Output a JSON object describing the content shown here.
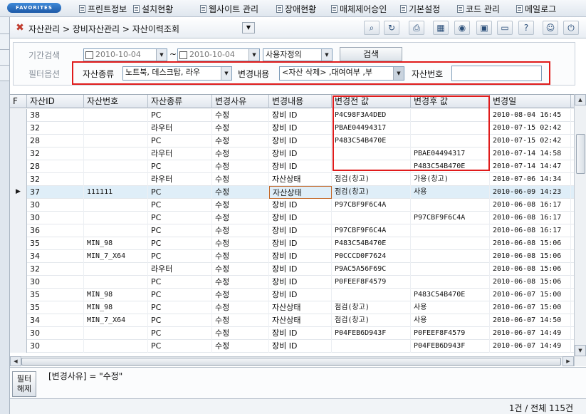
{
  "favorites": {
    "badge": "FAVORITES",
    "items": [
      "프린트정보",
      "설치현황",
      "웹사이트 관리",
      "장애현황",
      "매체제어승인",
      "기본설정",
      "코드 관리",
      "메일로그"
    ]
  },
  "breadcrumb": {
    "text": "자산관리 > 장비자산관리 > 자산이력조회"
  },
  "toolbar": {
    "icons": [
      "search-icon",
      "refresh-icon",
      "print-icon",
      "excel-icon",
      "disk-icon",
      "save-icon",
      "card-icon",
      "help-icon",
      "user-icon",
      "exit-icon"
    ]
  },
  "search": {
    "period_label": "기간검색",
    "date_from": "2010-10-04",
    "tilde": "~",
    "date_to": "2010-10-04",
    "period_type": "사용자정의",
    "search_button": "검색",
    "filter_label": "필터옵션",
    "asset_type_label": "자산종류",
    "asset_type_value": "노트북, 데스크탑, 라우",
    "change_label": "변경내용",
    "change_value": "<자산 삭제> ,대여여부 ,부",
    "asset_no_label": "자산번호",
    "asset_no_value": ""
  },
  "grid": {
    "columns": [
      "F",
      "자산ID",
      "자산번호",
      "자산종류",
      "변경사유",
      "변경내용",
      "변경전 값",
      "변경후 값",
      "변경일"
    ],
    "rows": [
      {
        "id": "38",
        "no": "",
        "type": "PC",
        "reason": "수정",
        "content": "장비 ID",
        "before": "P4C98F3A4DED",
        "after": "",
        "date": "2010-08-04 16:45",
        "extra": "2"
      },
      {
        "id": "32",
        "no": "",
        "type": "라우터",
        "reason": "수정",
        "content": "장비 ID",
        "before": "PBAE04494317",
        "after": "",
        "date": "2010-07-15 02:42",
        "extra": "2"
      },
      {
        "id": "28",
        "no": "",
        "type": "PC",
        "reason": "수정",
        "content": "장비 ID",
        "before": "P483C54B470E",
        "after": "",
        "date": "2010-07-15 02:42",
        "extra": "2"
      },
      {
        "id": "32",
        "no": "",
        "type": "라우터",
        "reason": "수정",
        "content": "장비 ID",
        "before": "",
        "after": "PBAE04494317",
        "date": "2010-07-14 14:58",
        "extra": "2"
      },
      {
        "id": "28",
        "no": "",
        "type": "PC",
        "reason": "수정",
        "content": "장비 ID",
        "before": "",
        "after": "P483C54B470E",
        "date": "2010-07-14 14:47",
        "extra": "2"
      },
      {
        "id": "32",
        "no": "",
        "type": "라우터",
        "reason": "수정",
        "content": "자산상태",
        "before": "점검(창고)",
        "after": "가용(창고)",
        "date": "2010-07-06 14:34",
        "extra": ""
      },
      {
        "id": "37",
        "no": "111111",
        "type": "PC",
        "reason": "수정",
        "content": "자산상태",
        "before": "점검(창고)",
        "after": "사용",
        "date": "2010-06-09 14:23",
        "extra": "",
        "selected": true
      },
      {
        "id": "30",
        "no": "",
        "type": "PC",
        "reason": "수정",
        "content": "장비 ID",
        "before": "P97CBF9F6C4A",
        "after": "",
        "date": "2010-06-08 16:17",
        "extra": "2"
      },
      {
        "id": "30",
        "no": "",
        "type": "PC",
        "reason": "수정",
        "content": "장비 ID",
        "before": "",
        "after": "P97CBF9F6C4A",
        "date": "2010-06-08 16:17",
        "extra": "2"
      },
      {
        "id": "36",
        "no": "",
        "type": "PC",
        "reason": "수정",
        "content": "장비 ID",
        "before": "P97CBF9F6C4A",
        "after": "",
        "date": "2010-06-08 16:17",
        "extra": "2"
      },
      {
        "id": "35",
        "no": "MIN_98",
        "type": "PC",
        "reason": "수정",
        "content": "장비 ID",
        "before": "P483C54B470E",
        "after": "",
        "date": "2010-06-08 15:06",
        "extra": "2"
      },
      {
        "id": "34",
        "no": "MIN_7_X64",
        "type": "PC",
        "reason": "수정",
        "content": "장비 ID",
        "before": "P0CCCD0F7624",
        "after": "",
        "date": "2010-06-08 15:06",
        "extra": "2"
      },
      {
        "id": "32",
        "no": "",
        "type": "라우터",
        "reason": "수정",
        "content": "장비 ID",
        "before": "P9AC5A56F69C",
        "after": "",
        "date": "2010-06-08 15:06",
        "extra": "2"
      },
      {
        "id": "30",
        "no": "",
        "type": "PC",
        "reason": "수정",
        "content": "장비 ID",
        "before": "P0FEEF8F4579",
        "after": "",
        "date": "2010-06-08 15:06",
        "extra": "2"
      },
      {
        "id": "35",
        "no": "MIN_98",
        "type": "PC",
        "reason": "수정",
        "content": "장비 ID",
        "before": "",
        "after": "P483C54B470E",
        "date": "2010-06-07 15:00",
        "extra": "2"
      },
      {
        "id": "35",
        "no": "MIN_98",
        "type": "PC",
        "reason": "수정",
        "content": "자산상태",
        "before": "점검(창고)",
        "after": "사용",
        "date": "2010-06-07 15:00",
        "extra": ""
      },
      {
        "id": "34",
        "no": "MIN_7_X64",
        "type": "PC",
        "reason": "수정",
        "content": "자산상태",
        "before": "점검(창고)",
        "after": "사용",
        "date": "2010-06-07 14:50",
        "extra": ""
      },
      {
        "id": "30",
        "no": "",
        "type": "PC",
        "reason": "수정",
        "content": "장비 ID",
        "before": "P04FEB6D943F",
        "after": "P0FEEF8F4579",
        "date": "2010-06-07 14:49",
        "extra": "2"
      },
      {
        "id": "30",
        "no": "",
        "type": "PC",
        "reason": "수정",
        "content": "장비 ID",
        "before": "",
        "after": "P04FEB6D943F",
        "date": "2010-06-07 14:49",
        "extra": "2"
      }
    ]
  },
  "filter": {
    "button": "필터\n해제",
    "expression": "[변경사유] = \"수정\""
  },
  "status": {
    "text": "1건 / 전체 115건"
  }
}
